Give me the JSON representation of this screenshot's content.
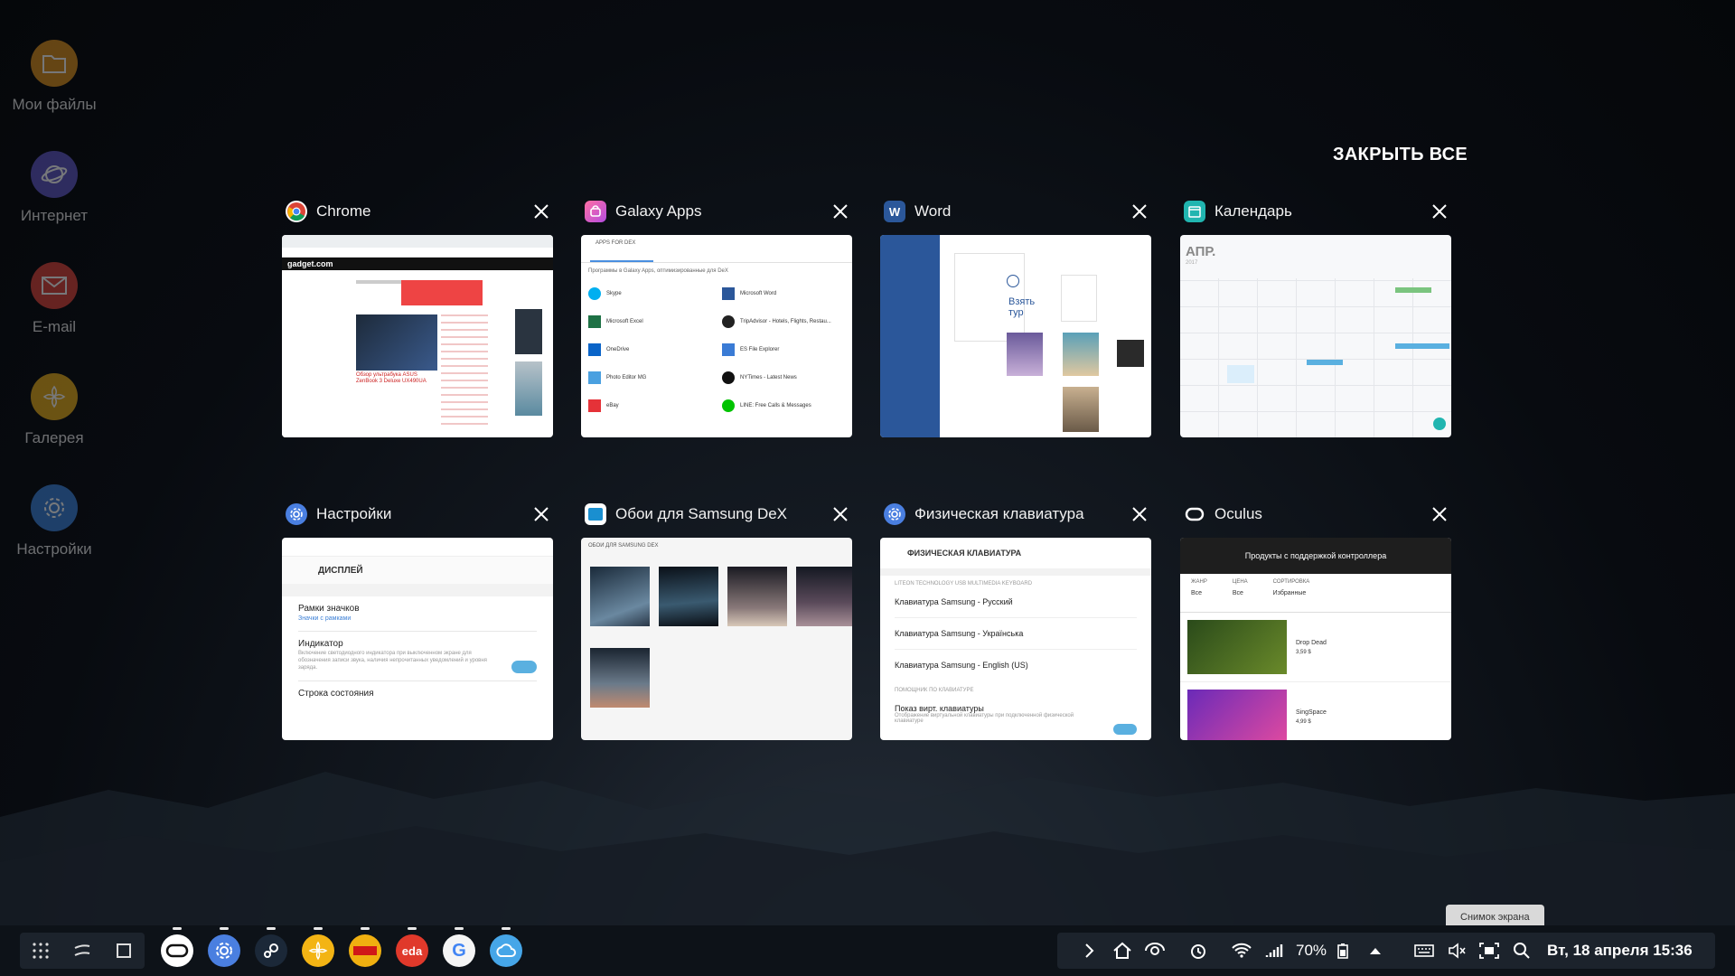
{
  "desktop": {
    "icons": [
      {
        "label": "Мои файлы",
        "icon": "folder-icon",
        "color": "#d98f1f"
      },
      {
        "label": "Интернет",
        "icon": "internet-icon",
        "color": "#5f57c4"
      },
      {
        "label": "E-mail",
        "icon": "mail-icon",
        "color": "#d9433a"
      },
      {
        "label": "Галерея",
        "icon": "gallery-icon",
        "color": "#e5ac1a"
      },
      {
        "label": "Настройки",
        "icon": "settings-icon",
        "color": "#3b7fd6"
      }
    ]
  },
  "recents": {
    "close_all": "ЗАКРЫТЬ ВСЕ",
    "cards": [
      {
        "title": "Chrome",
        "icon": "chrome-icon"
      },
      {
        "title": "Galaxy Apps",
        "icon": "galaxy-apps-icon"
      },
      {
        "title": "Word",
        "icon": "word-icon"
      },
      {
        "title": "Календарь",
        "icon": "calendar-icon"
      },
      {
        "title": "Настройки",
        "icon": "settings-icon"
      },
      {
        "title": "Обои для Samsung DeX",
        "icon": "wallpaper-icon"
      },
      {
        "title": "Физическая клавиатура",
        "icon": "settings-icon"
      },
      {
        "title": "Oculus",
        "icon": "oculus-icon"
      }
    ]
  },
  "thumbs": {
    "chrome": {
      "site": "gadget.com",
      "headline": "Обзор ультрабука ASUS ZenBook 3 Deluxe UX490UA"
    },
    "galaxy": {
      "header": "APPS FOR DEX",
      "intro": "Программы в Galaxy Apps, оптимизированные для DeX",
      "left": [
        "Skype",
        "Microsoft Excel",
        "OneDrive",
        "Photo Editor MG",
        "eBay"
      ],
      "right": [
        "Microsoft Word",
        "TripAdvisor - Hotels, Flights, Restau...",
        "ES File Explorer",
        "NYTimes - Latest News",
        "LINE: Free Calls & Messages"
      ]
    },
    "word": {
      "tour": "Взять тур"
    },
    "calendar": {
      "month": "АПР.",
      "year": "2017"
    },
    "settings": {
      "title": "ДИСПЛЕЙ",
      "items": [
        {
          "title": "Рамки значков",
          "sub": "Значки с рамками"
        },
        {
          "title": "Индикатор",
          "sub": "Включение светодиодного индикатора при выключенном экране для обозначения записи звука, наличия непрочитанных уведомлений и уровня заряда."
        },
        {
          "title": "Строка состояния",
          "sub": ""
        }
      ]
    },
    "wallpaper": {
      "header": "ОБОИ ДЛЯ SAMSUNG DEX"
    },
    "keyboard": {
      "title": "ФИЗИЧЕСКАЯ КЛАВИАТУРА",
      "section1": "LITEON TECHNOLOGY USB MULTIMEDIA KEYBOARD",
      "items": [
        "Клавиатура Samsung - Русский",
        "Клавиатура Samsung - Українська",
        "Клавиатура Samsung - English (US)"
      ],
      "section2": "ПОМОЩНИК ПО КЛАВИАТУРЕ",
      "toggle_title": "Показ вирт. клавиатуры",
      "toggle_sub": "Отображение виртуальной клавиатуры при подключенной физической клавиатуре"
    },
    "oculus": {
      "title": "Продукты с поддержкой контроллера",
      "filters": [
        {
          "label": "ЖАНР",
          "value": "Все"
        },
        {
          "label": "ЦЕНА",
          "value": "Все"
        },
        {
          "label": "СОРТИРОВКА",
          "value": "Избранные"
        }
      ],
      "items": [
        {
          "name": "Drop Dead",
          "price": "3,59 $"
        },
        {
          "name": "SingSpace",
          "price": "4,99 $"
        }
      ]
    }
  },
  "taskbar": {
    "battery": "70%",
    "datetime": "Вт, 18 апреля 15:36",
    "tooltip": "Снимок экрана",
    "pinned": [
      {
        "name": "oculus",
        "color": "#f2f2f2"
      },
      {
        "name": "settings",
        "color": "#4a7fe0"
      },
      {
        "name": "steam",
        "color": "#1b2838"
      },
      {
        "name": "gallery",
        "color": "#f3b414"
      },
      {
        "name": "news",
        "color": "#f0b010"
      },
      {
        "name": "eda",
        "color": "#e0392b"
      },
      {
        "name": "google",
        "color": "#f5f5f5"
      },
      {
        "name": "weather",
        "color": "#46a6e8"
      }
    ]
  }
}
